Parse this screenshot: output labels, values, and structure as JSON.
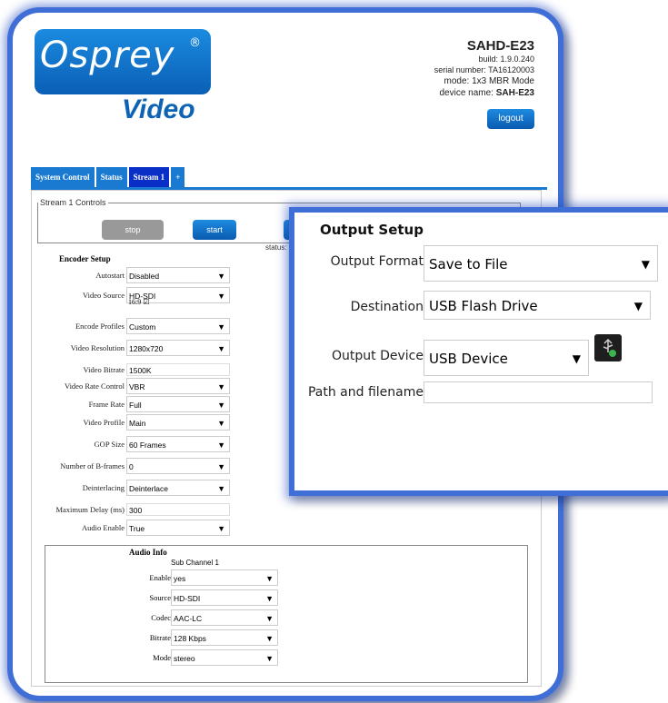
{
  "logo": {
    "text1": "Osprey",
    "reg": "®",
    "text2": "Video"
  },
  "device": {
    "model": "SAHD-E23",
    "build": "build: 1.9.0.240",
    "serial": "serial number: TA16120003",
    "mode": "mode: 1x3 MBR Mode",
    "name_label": "device name: ",
    "name_value": "SAH-E23",
    "logout_label": "logout"
  },
  "tabs": [
    "System Control",
    "Status",
    "Stream 1",
    "+"
  ],
  "stream_controls": {
    "legend": "Stream 1 Controls",
    "stop_label": "stop",
    "start_label": "start",
    "status_label": "status:"
  },
  "encoder": {
    "title": "Encoder Setup",
    "rows": [
      {
        "label": "Autostart",
        "value": "Disabled",
        "type": "select"
      },
      {
        "label": "Video Source",
        "value": "HD-SDI",
        "type": "select"
      },
      {
        "label": "Encode Profiles",
        "value": "Custom",
        "type": "select"
      },
      {
        "label": "Video Resolution",
        "value": "1280x720",
        "type": "select"
      },
      {
        "label": "Video Bitrate",
        "value": "1500K",
        "type": "text"
      },
      {
        "label": "Video Rate Control",
        "value": "VBR",
        "type": "select"
      },
      {
        "label": "Frame Rate",
        "value": "Full",
        "type": "select"
      },
      {
        "label": "Video Profile",
        "value": "Main",
        "type": "select"
      },
      {
        "label": "GOP Size",
        "value": "60 Frames",
        "type": "select"
      },
      {
        "label": "Number of B-frames",
        "value": "0",
        "type": "select"
      },
      {
        "label": "Deinterlacing",
        "value": "Deinterlace",
        "type": "select"
      },
      {
        "label": "Maximum Delay (ms)",
        "value": "300",
        "type": "text"
      },
      {
        "label": "Audio Enable",
        "value": "True",
        "type": "select"
      }
    ],
    "aspect_label": "16:9 ☑"
  },
  "audio": {
    "title": "Audio Info",
    "subchannel": "Sub Channel 1",
    "rows": [
      {
        "label": "Enable",
        "value": "yes"
      },
      {
        "label": "Source",
        "value": "HD-SDI"
      },
      {
        "label": "Codec",
        "value": "AAC-LC"
      },
      {
        "label": "Bitrate",
        "value": "128 Kbps"
      },
      {
        "label": "Mode",
        "value": "stereo"
      }
    ]
  },
  "output": {
    "title": "Output Setup",
    "format_label": "Output Format",
    "format_value": "Save to File",
    "destination_label": "Destination",
    "destination_value": "USB Flash Drive",
    "device_label": "Output Device",
    "device_value": "USB Device",
    "path_label": "Path and filename",
    "path_value": ""
  },
  "arrow_glyph": "▼"
}
